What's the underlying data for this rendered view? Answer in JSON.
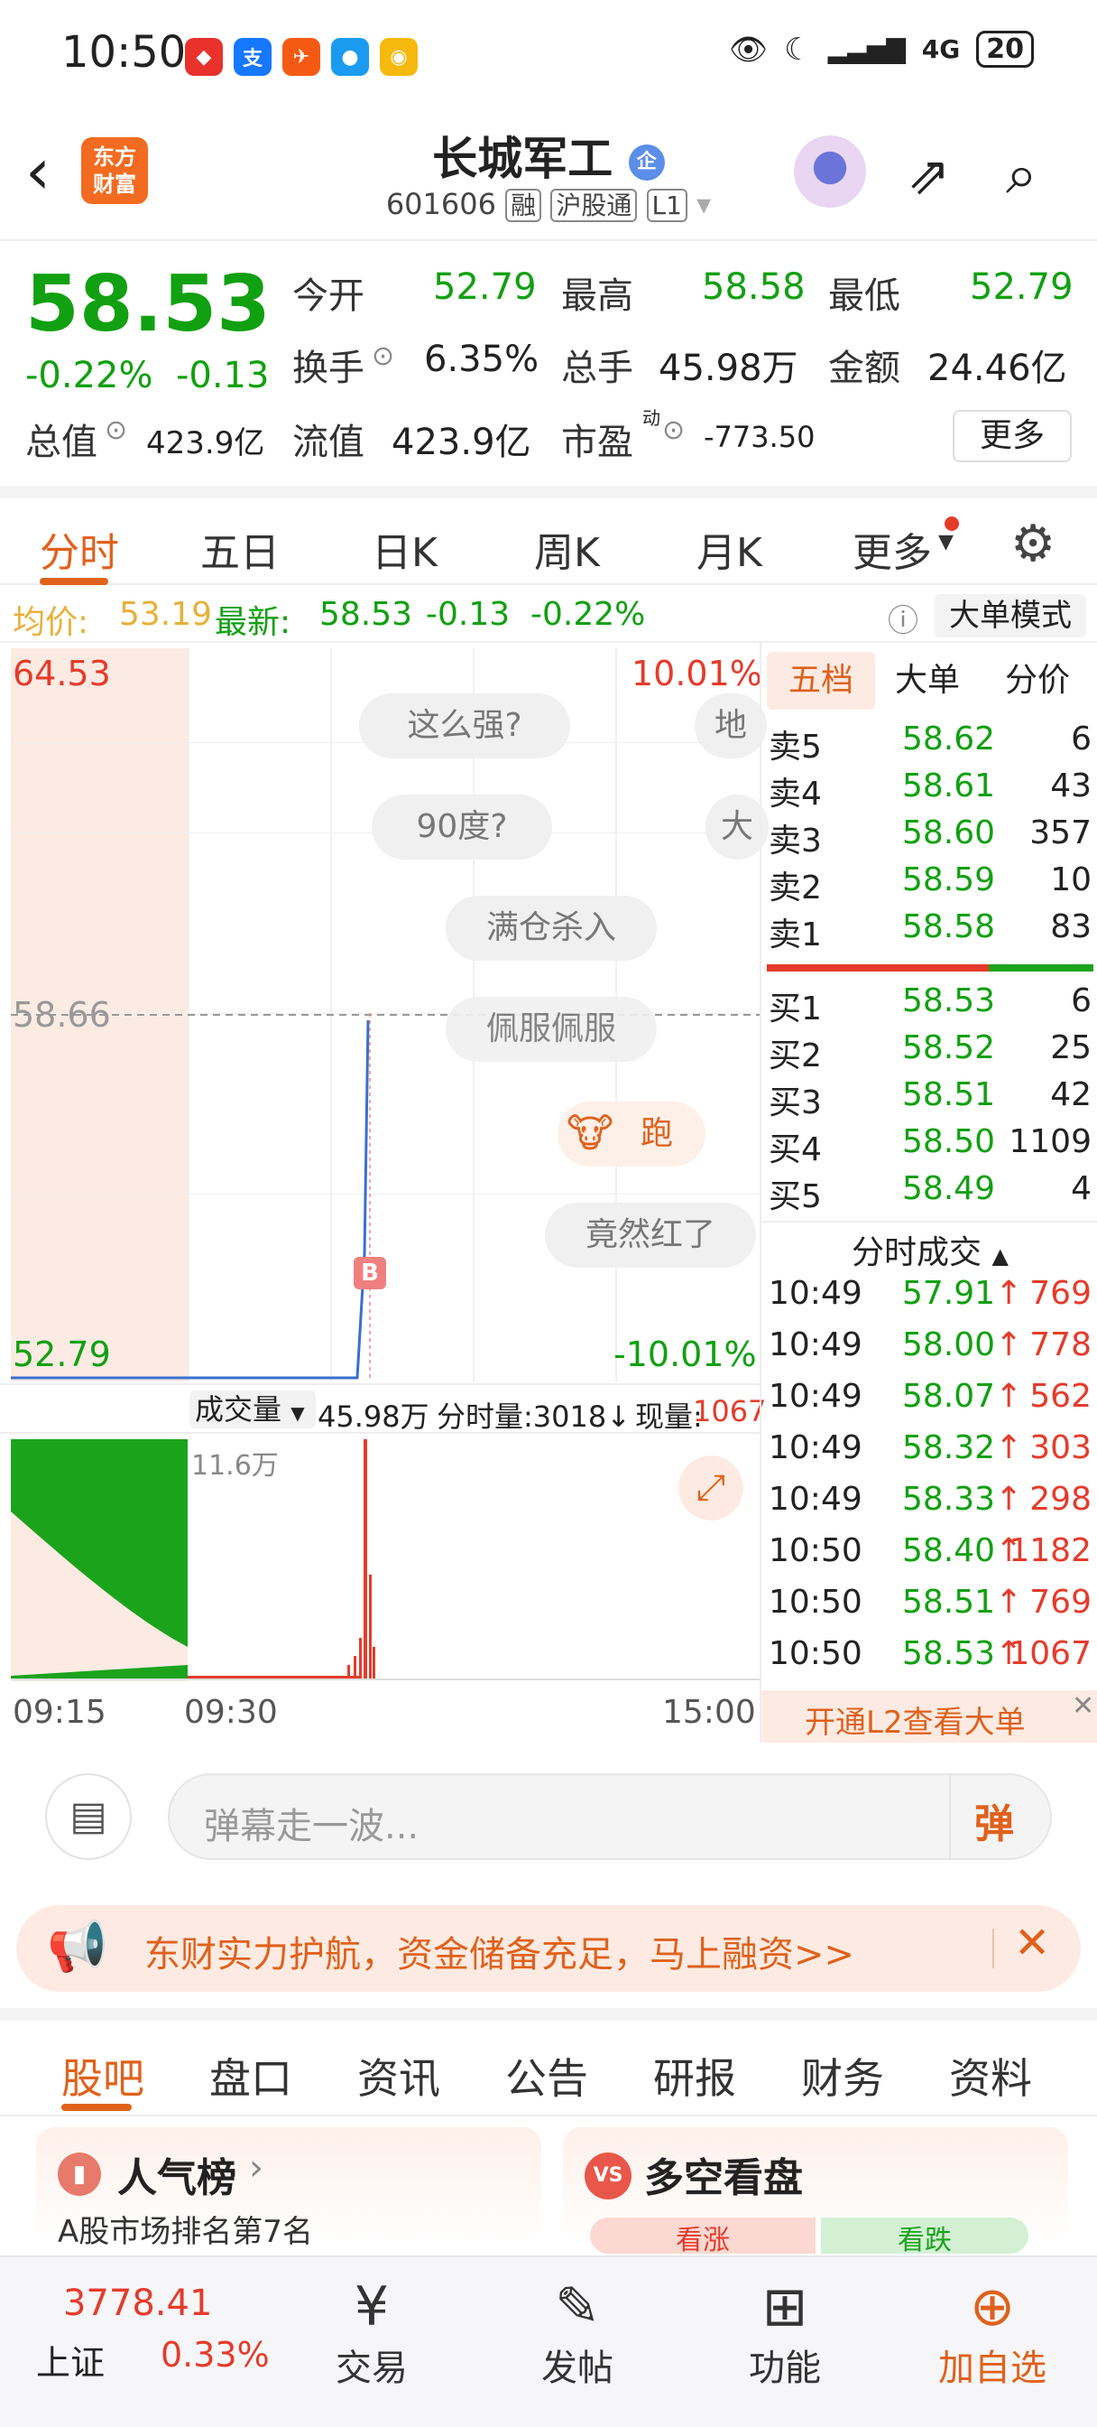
{
  "status_bar": {
    "time": "10:50",
    "network": "4G",
    "battery": "20"
  },
  "header": {
    "back_icon": "chevron-left",
    "logo_text_line1": "东方",
    "logo_text_line2": "财富",
    "stock_name": "长城军工",
    "stock_badge": "企",
    "stock_code": "601606",
    "tag_margin": "融",
    "tag_connect": "沪股通",
    "tag_level": "L1"
  },
  "quote": {
    "price": "58.53",
    "change_pct": "-0.22%",
    "change_amt": "-0.13",
    "open_label": "今开",
    "open_value": "52.79",
    "high_label": "最高",
    "high_value": "58.58",
    "low_label": "最低",
    "low_value": "52.79",
    "turnover_label": "换手",
    "turnover_value": "6.35%",
    "volume_label": "总手",
    "volume_value": "45.98万",
    "amount_label": "金额",
    "amount_value": "24.46亿",
    "mcap_label": "总值",
    "mcap_value": "423.9亿",
    "float_label": "流值",
    "float_value": "423.9亿",
    "pe_label": "市盈",
    "pe_sup": "动",
    "pe_value": "-773.50",
    "more_label": "更多"
  },
  "tabs": [
    "分时",
    "五日",
    "日K",
    "周K",
    "月K",
    "更多"
  ],
  "infoline": {
    "avg_label": "均价:",
    "avg_value": "53.19",
    "latest_label": "最新:",
    "latest_value": "58.53",
    "latest_chg": "-0.13",
    "latest_pct": "-0.22%",
    "mode_button": "大单模式"
  },
  "chart": {
    "y_top": "64.53",
    "y_mid": "58.66",
    "y_bottom": "52.79",
    "pct_top": "10.01%",
    "pct_bottom": "-10.01%",
    "buy_marker": "B",
    "vol_selector": "成交量",
    "vol_total": "45.98万",
    "vol_minute": "分时量:3018↓",
    "vol_now_label": "现量:",
    "vol_now_value": "1067",
    "vol_max": "11.6万",
    "time_start": "09:15",
    "time_open": "09:30",
    "time_end": "15:00"
  },
  "chart_data": {
    "type": "line",
    "ylim": [
      52.79,
      64.53
    ],
    "x": [
      "09:15",
      "09:30",
      "10:50"
    ],
    "series": [
      {
        "values": [
          52.79,
          52.79,
          58.66
        ]
      }
    ]
  },
  "danmu": [
    "这么强?",
    "地",
    "90度?",
    "大",
    "满仓杀入",
    "佩服佩服",
    "跑",
    "竟然红了"
  ],
  "book": {
    "tabs": [
      "五档",
      "大单",
      "分价"
    ],
    "asks": [
      {
        "label": "卖5",
        "price": "58.62",
        "qty": "6"
      },
      {
        "label": "卖4",
        "price": "58.61",
        "qty": "43"
      },
      {
        "label": "卖3",
        "price": "58.60",
        "qty": "357"
      },
      {
        "label": "卖2",
        "price": "58.59",
        "qty": "10"
      },
      {
        "label": "卖1",
        "price": "58.58",
        "qty": "83"
      }
    ],
    "bids": [
      {
        "label": "买1",
        "price": "58.53",
        "qty": "6"
      },
      {
        "label": "买2",
        "price": "58.52",
        "qty": "25"
      },
      {
        "label": "买3",
        "price": "58.51",
        "qty": "42"
      },
      {
        "label": "买4",
        "price": "58.50",
        "qty": "1109"
      },
      {
        "label": "买5",
        "price": "58.49",
        "qty": "4"
      }
    ],
    "trades_title": "分时成交",
    "trades": [
      {
        "time": "10:49",
        "price": "57.91↑",
        "qty": "769"
      },
      {
        "time": "10:49",
        "price": "58.00↑",
        "qty": "778"
      },
      {
        "time": "10:49",
        "price": "58.07↑",
        "qty": "562"
      },
      {
        "time": "10:49",
        "price": "58.32↑",
        "qty": "303"
      },
      {
        "time": "10:49",
        "price": "58.33↑",
        "qty": "298"
      },
      {
        "time": "10:50",
        "price": "58.40↑",
        "qty": "1182"
      },
      {
        "time": "10:50",
        "price": "58.51↑",
        "qty": "769"
      },
      {
        "time": "10:50",
        "price": "58.53↑",
        "qty": "1067"
      }
    ],
    "l2_link": "开通L2查看大单"
  },
  "danmu_input": {
    "placeholder": "弹幕走一波...",
    "send_label": "弹"
  },
  "promo": {
    "text": "东财实力护航，资金储备充足，马上融资>>"
  },
  "section_tabs": [
    "股吧",
    "盘口",
    "资讯",
    "公告",
    "研报",
    "财务",
    "资料"
  ],
  "cards": {
    "left_title": "人气榜",
    "left_sub": "A股市场排名第7名",
    "right_badge": "VS",
    "right_title": "多空看盘",
    "right_up": "看涨",
    "right_down": "看跌"
  },
  "bottom_nav": {
    "index_value": "3778.41",
    "index_name": "上证",
    "index_pct": "0.33%",
    "trade": "交易",
    "post": "发帖",
    "func": "功能",
    "add": "加自选"
  }
}
